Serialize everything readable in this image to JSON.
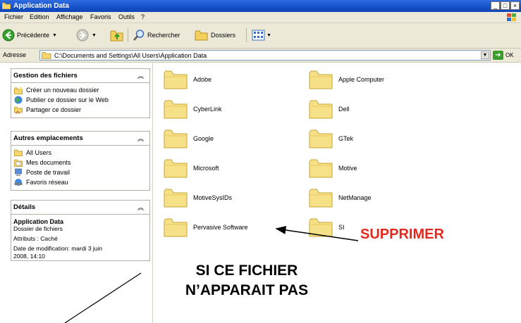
{
  "window": {
    "title": "Application Data",
    "controls": [
      "_",
      "□",
      "×"
    ]
  },
  "menu": [
    "Fichier",
    "Edition",
    "Affichage",
    "Favoris",
    "Outils",
    "?"
  ],
  "toolbar": {
    "back": "Précédente",
    "search": "Rechercher",
    "folders": "Dossiers"
  },
  "address": {
    "label": "Adresse",
    "path": "C:\\Documents and Settings\\All Users\\Application Data",
    "go": "OK"
  },
  "tasks": {
    "title": "Gestion des fichiers",
    "items": [
      "Créer un nouveau dossier",
      "Publier ce dossier sur le Web",
      "Partager ce dossier"
    ]
  },
  "places": {
    "title": "Autres emplacements",
    "items": [
      "All Users",
      "Mes documents",
      "Poste de travail",
      "Favoris réseau"
    ]
  },
  "details": {
    "title": "Détails",
    "name": "Application Data",
    "type": "Dossier de fichiers",
    "attributes": "Attributs : Caché",
    "modified_label": "Date de modification: mardi 3 juin",
    "modified_rest": "2008, 14:10"
  },
  "files": [
    "Adobe",
    "Apple Computer",
    "CyberLink",
    "Dell",
    "Google",
    "GTek",
    "Microsoft",
    "Motive",
    "MotiveSysIDs",
    "NetManage",
    "Pervasive Software",
    "SI"
  ],
  "annotations": {
    "delete_label": "SUPPRIMER",
    "note_line1": "SI CE FICHIER",
    "note_line2": "N’APPARAIT PAS",
    "delete_color": "#e42a1e"
  }
}
